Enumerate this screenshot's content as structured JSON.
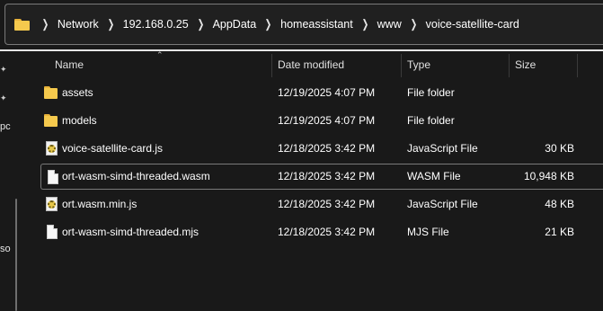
{
  "breadcrumb": {
    "items": [
      "Network",
      "192.168.0.25",
      "AppData",
      "homeassistant",
      "www",
      "voice-satellite-card"
    ]
  },
  "nav": {
    "partial_labels": [
      "pc",
      "so"
    ]
  },
  "columns": {
    "name": "Name",
    "date": "Date modified",
    "type": "Type",
    "size": "Size"
  },
  "files": [
    {
      "name": "assets",
      "date": "12/19/2025 4:07 PM",
      "type": "File folder",
      "size": "",
      "icon": "folder-icon"
    },
    {
      "name": "models",
      "date": "12/19/2025 4:07 PM",
      "type": "File folder",
      "size": "",
      "icon": "folder-icon"
    },
    {
      "name": "voice-satellite-card.js",
      "date": "12/18/2025 3:42 PM",
      "type": "JavaScript File",
      "size": "30 KB",
      "icon": "javascript-file-icon"
    },
    {
      "name": "ort-wasm-simd-threaded.wasm",
      "date": "12/18/2025 3:42 PM",
      "type": "WASM File",
      "size": "10,948 KB",
      "icon": "file-icon"
    },
    {
      "name": "ort.wasm.min.js",
      "date": "12/18/2025 3:42 PM",
      "type": "JavaScript File",
      "size": "48 KB",
      "icon": "javascript-file-icon"
    },
    {
      "name": "ort-wasm-simd-threaded.mjs",
      "date": "12/18/2025 3:42 PM",
      "type": "MJS File",
      "size": "21 KB",
      "icon": "file-icon"
    }
  ]
}
